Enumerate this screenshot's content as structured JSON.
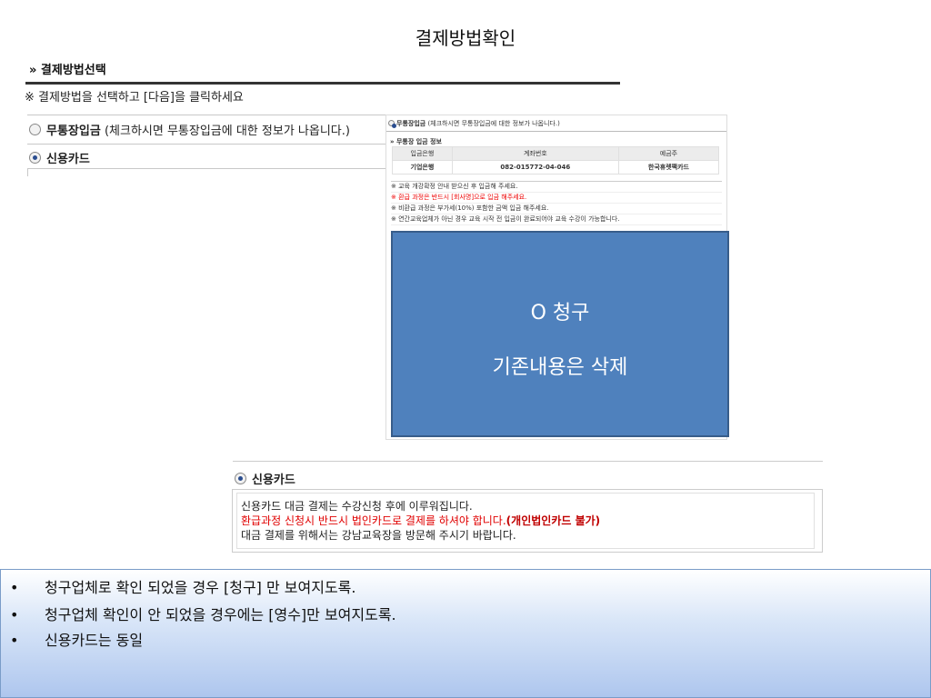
{
  "page_title": "결제방법확인",
  "section": {
    "header": "» 결제방법선택",
    "instruction": "※ 결제방법을 선택하고 [다음]을 클릭하세요",
    "options": [
      {
        "label": "무통장입금",
        "desc": "(체크하시면 무통장입금에 대한 정보가 나옵니다.)",
        "selected": false
      },
      {
        "label": "신용카드",
        "desc": "",
        "selected": true
      }
    ]
  },
  "bank_panel": {
    "option_label": "무통장입금",
    "option_desc": "(체크하시면 무통장입금에 대한 정보가 나옵니다.)",
    "info_title": "» 무통장 입금 정보",
    "columns": [
      "입금은행",
      "계좌번호",
      "예금주"
    ],
    "row": [
      "기업은행",
      "082-015772-04-046",
      "한국휴렛팩카드"
    ],
    "notes": [
      "※ 교육 개강확정 안내 받으신 후 입금해 주세요.",
      "※ 환급 과정은 반드시 [회사명]으로 입금 해주세요.",
      "※ 비환급 과정은 부가세(10%) 포함한 금액 입금 해주세요.",
      "※ 연간교육업체가 아닌 경우 교육 시작 전 입금이 완료되어야 교육 수강이 가능합니다."
    ]
  },
  "overlay": {
    "line1": "O 청구",
    "line2": "기존내용은 삭제",
    "color": "#4f81bd"
  },
  "credit_card": {
    "title": "신용카드",
    "line1": "신용카드 대금 결제는 수강신청 후에 이루워집니다.",
    "line2_red": "환급과정 신청시 반드시 법인카드로 결제를 하셔야 합니다.",
    "line2_bold": "(개인법인카드 불가)",
    "line3": "대금 결제를 위해서는 강남교육장을 방문해 주시기 바랍니다."
  },
  "notes": [
    "청구업체로 확인 되었을 경우 [청구] 만 보여지도록.",
    "청구업체 확인이 안 되었을 경우에는 [영수]만 보여지도록.",
    "신용카드는 동일"
  ],
  "bullet": "•"
}
